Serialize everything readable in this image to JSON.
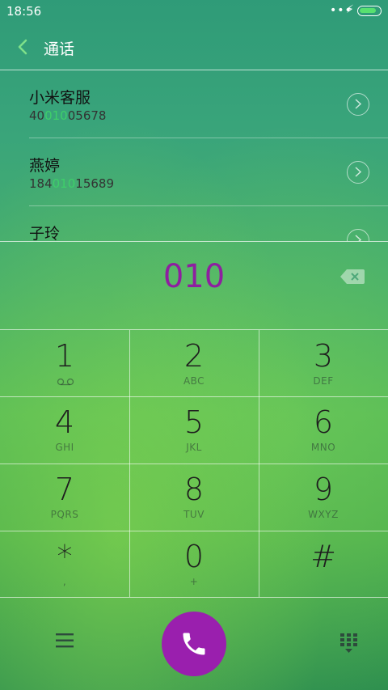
{
  "status": {
    "time": "18:56",
    "battery_level": 0.85
  },
  "header": {
    "title": "通话"
  },
  "contacts": [
    {
      "name": "小米客服",
      "number_prefix": "40",
      "number_match": "010",
      "number_suffix": "05678"
    },
    {
      "name": "燕婷",
      "number_prefix": "184",
      "number_match": "010",
      "number_suffix": "15689"
    },
    {
      "name": "子玲"
    }
  ],
  "dialer": {
    "input": "010"
  },
  "keys": [
    {
      "digit": "1",
      "letters": ""
    },
    {
      "digit": "2",
      "letters": "ABC"
    },
    {
      "digit": "3",
      "letters": "DEF"
    },
    {
      "digit": "4",
      "letters": "GHI"
    },
    {
      "digit": "5",
      "letters": "JKL"
    },
    {
      "digit": "6",
      "letters": "MNO"
    },
    {
      "digit": "7",
      "letters": "PQRS"
    },
    {
      "digit": "8",
      "letters": "TUV"
    },
    {
      "digit": "9",
      "letters": "WXYZ"
    },
    {
      "digit": "*",
      "letters": ","
    },
    {
      "digit": "0",
      "letters": "+"
    },
    {
      "digit": "#",
      "letters": ""
    }
  ],
  "colors": {
    "accent": "#9a1fae",
    "match_highlight": "#3ecf6a"
  },
  "icons": {
    "back": "chevron-left-icon",
    "backspace": "backspace-icon",
    "menu": "menu-icon",
    "call": "phone-icon",
    "dialpad": "dialpad-icon",
    "voicemail": "voicemail-icon"
  }
}
